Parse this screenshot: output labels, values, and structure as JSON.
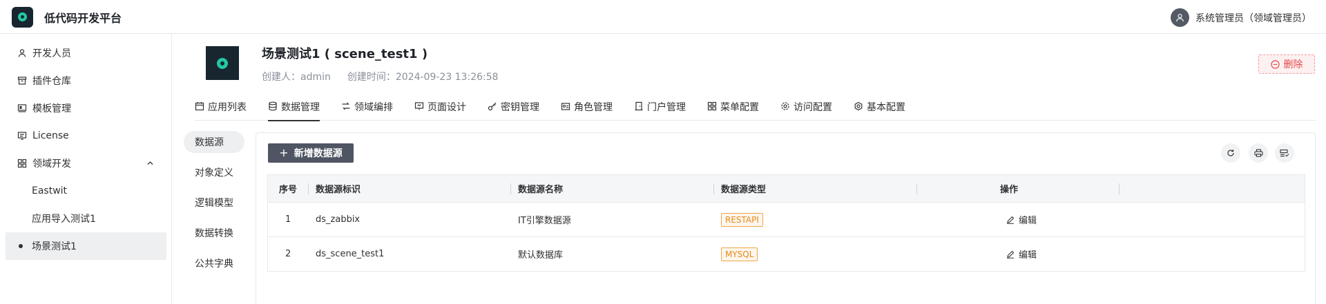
{
  "header": {
    "app_title": "低代码开发平台",
    "user_name": "系统管理员（领域管理员）"
  },
  "sidebar": {
    "items": [
      {
        "label": "开发人员",
        "icon": "user-icon"
      },
      {
        "label": "插件仓库",
        "icon": "archive-icon"
      },
      {
        "label": "模板管理",
        "icon": "template-icon"
      },
      {
        "label": "License",
        "icon": "license-icon"
      },
      {
        "label": "领域开发",
        "icon": "grid-icon",
        "expanded": true
      },
      {
        "label": "Eastwit"
      },
      {
        "label": "应用导入测试1"
      },
      {
        "label": "场景测试1",
        "active": true
      }
    ]
  },
  "app": {
    "name": "场景测试1 ( scene_test1 )",
    "creator": "创建人：admin",
    "created_time": "创建时间：2024-09-23 13:26:58",
    "delete_label": "删除"
  },
  "tabs": [
    {
      "label": "应用列表",
      "icon": "calendar-icon"
    },
    {
      "label": "数据管理",
      "icon": "database-icon",
      "active": true
    },
    {
      "label": "领域编排",
      "icon": "flow-icon"
    },
    {
      "label": "页面设计",
      "icon": "page-design-icon"
    },
    {
      "label": "密钥管理",
      "icon": "key-icon"
    },
    {
      "label": "角色管理",
      "icon": "role-icon"
    },
    {
      "label": "门户管理",
      "icon": "door-icon"
    },
    {
      "label": "菜单配置",
      "icon": "menu-grid-icon"
    },
    {
      "label": "访问配置",
      "icon": "gear-icon"
    },
    {
      "label": "基本配置",
      "icon": "settings-icon"
    }
  ],
  "subnav": [
    {
      "label": "数据源",
      "active": true
    },
    {
      "label": "对象定义"
    },
    {
      "label": "逻辑模型"
    },
    {
      "label": "数据转换"
    },
    {
      "label": "公共字典"
    }
  ],
  "toolbar": {
    "add_label": "新增数据源"
  },
  "table": {
    "columns": [
      "序号",
      "数据源标识",
      "数据源名称",
      "数据源类型",
      "操作"
    ],
    "rows": [
      {
        "index": "1",
        "id": "ds_zabbix",
        "name": "IT引擎数据源",
        "type": "RESTAPI",
        "action": "编辑"
      },
      {
        "index": "2",
        "id": "ds_scene_test1",
        "name": "默认数据库",
        "type": "MYSQL",
        "action": "编辑"
      }
    ]
  },
  "colors": {
    "brand_dark": "#17262f",
    "brand_accent": "#24c6a4",
    "danger": "#e5484d",
    "badge_orange": "#e8891a"
  }
}
